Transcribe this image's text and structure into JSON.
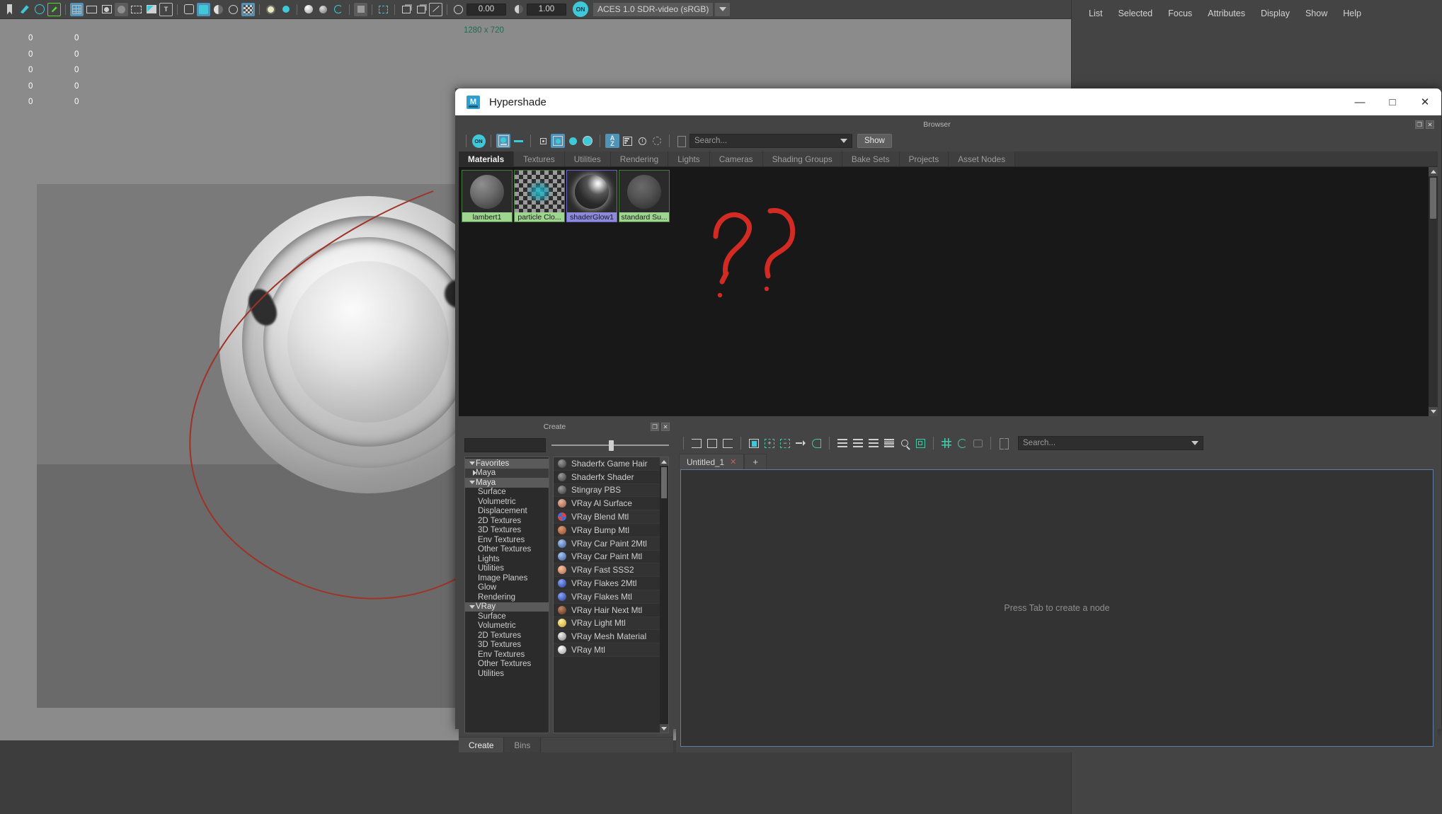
{
  "maya": {
    "statusline": {
      "numeric_fields": [
        "0.00",
        "1.00"
      ],
      "on_toggle_label": "ON",
      "colorspace": "ACES 1.0 SDR-video (sRGB)",
      "icons": [
        "bookmark-icon",
        "paint-brush-icon",
        "move-snap-icon",
        "pencil-icon",
        "grid-snap-icon",
        "view-snap-icon",
        "point-snap-icon",
        "plane-snap-icon",
        "render-region-icon",
        "image-snap-icon",
        "text-snap-icon",
        "cube-wire-icon",
        "cube-solid-icon",
        "half-shade-icon",
        "cage-icon",
        "checker-icon",
        "light-icon",
        "shaded-sphere-icon",
        "texture-sphere-icon",
        "xray-sphere-icon",
        "wire-circle-icon",
        "object-mask-icon",
        "select-marquee-icon",
        "duplicate-icon",
        "copy-icon",
        "diagonal-icon",
        "aperture-icon",
        "contrast-icon"
      ]
    },
    "viewport": {
      "resolution_label": "1280 x 720",
      "hud_left_column": [
        "0",
        "0",
        "0",
        "0",
        "0"
      ],
      "hud_right_column": [
        "0",
        "0",
        "0",
        "0",
        "0"
      ]
    },
    "right_panel": {
      "menu": [
        "List",
        "Selected",
        "Focus",
        "Attributes",
        "Display",
        "Show",
        "Help"
      ]
    }
  },
  "hypershade": {
    "title": "Hypershade",
    "window_buttons": {
      "minimize": "—",
      "maximize": "□",
      "close": "✕"
    },
    "browser": {
      "panel_title": "Browser",
      "panel_buttons": {
        "float": "❐",
        "close": "✕"
      },
      "toolbar": {
        "search_placeholder": "Search...",
        "show_button": "Show",
        "icons": [
          "toggle-on-icon",
          "render-swatch-icon",
          "clear-graph-icon",
          "small-swatch-icon",
          "medium-swatch-icon",
          "large-swatch-icon",
          "xlarge-swatch-icon",
          "sort-alphabetical-icon",
          "sort-reverse-icon",
          "sort-time-icon",
          "refresh-icon",
          "expand-brackets-icon"
        ]
      },
      "tabs": [
        {
          "label": "Materials",
          "active": true
        },
        {
          "label": "Textures",
          "active": false
        },
        {
          "label": "Utilities",
          "active": false
        },
        {
          "label": "Rendering",
          "active": false
        },
        {
          "label": "Lights",
          "active": false
        },
        {
          "label": "Cameras",
          "active": false
        },
        {
          "label": "Shading Groups",
          "active": false
        },
        {
          "label": "Bake Sets",
          "active": false
        },
        {
          "label": "Projects",
          "active": false
        },
        {
          "label": "Asset Nodes",
          "active": false
        }
      ],
      "swatches": [
        {
          "label": "lambert1",
          "kind": "lambert",
          "selected": false
        },
        {
          "label": "particle Clo...",
          "kind": "particlecloud",
          "selected": false
        },
        {
          "label": "shaderGlow1",
          "kind": "glow",
          "selected": true
        },
        {
          "label": "standard Su...",
          "kind": "standard",
          "selected": false
        }
      ],
      "annotation": "red-question-marks"
    },
    "create_panel": {
      "panel_title": "Create",
      "panel_buttons": {
        "float": "❐",
        "close": "✕"
      },
      "filter_value": "",
      "tree": [
        {
          "label": "Favorites",
          "level": 0,
          "state": "expanded",
          "style": "grp"
        },
        {
          "label": "Maya",
          "level": 1,
          "state": "collapsed",
          "style": "sub"
        },
        {
          "label": "Maya",
          "level": 0,
          "state": "expanded",
          "style": "grp"
        },
        {
          "label": "Surface",
          "level": 1,
          "state": "leaf",
          "style": "child"
        },
        {
          "label": "Volumetric",
          "level": 1,
          "state": "leaf",
          "style": "child"
        },
        {
          "label": "Displacement",
          "level": 1,
          "state": "leaf",
          "style": "child"
        },
        {
          "label": "2D Textures",
          "level": 1,
          "state": "leaf",
          "style": "child"
        },
        {
          "label": "3D Textures",
          "level": 1,
          "state": "leaf",
          "style": "child"
        },
        {
          "label": "Env Textures",
          "level": 1,
          "state": "leaf",
          "style": "child"
        },
        {
          "label": "Other Textures",
          "level": 1,
          "state": "leaf",
          "style": "child"
        },
        {
          "label": "Lights",
          "level": 1,
          "state": "leaf",
          "style": "child"
        },
        {
          "label": "Utilities",
          "level": 1,
          "state": "leaf",
          "style": "child"
        },
        {
          "label": "Image Planes",
          "level": 1,
          "state": "leaf",
          "style": "child"
        },
        {
          "label": "Glow",
          "level": 1,
          "state": "leaf",
          "style": "child"
        },
        {
          "label": "Rendering",
          "level": 1,
          "state": "leaf",
          "style": "child"
        },
        {
          "label": "VRay",
          "level": 0,
          "state": "expanded",
          "style": "grp"
        },
        {
          "label": "Surface",
          "level": 1,
          "state": "leaf",
          "style": "child"
        },
        {
          "label": "Volumetric",
          "level": 1,
          "state": "leaf",
          "style": "child"
        },
        {
          "label": "2D Textures",
          "level": 1,
          "state": "leaf",
          "style": "child"
        },
        {
          "label": "3D Textures",
          "level": 1,
          "state": "leaf",
          "style": "child"
        },
        {
          "label": "Env Textures",
          "level": 1,
          "state": "leaf",
          "style": "child"
        },
        {
          "label": "Other Textures",
          "level": 1,
          "state": "leaf",
          "style": "child"
        },
        {
          "label": "Utilities",
          "level": 1,
          "state": "leaf",
          "style": "child"
        }
      ],
      "node_list": [
        {
          "label": "Shaderfx Game Hair",
          "color": "#6f6f6f"
        },
        {
          "label": "Shaderfx Shader",
          "color": "#6f6f6f"
        },
        {
          "label": "Stingray PBS",
          "color": "#6f6f6f"
        },
        {
          "label": "VRay Al Surface",
          "color": "#d8a08a"
        },
        {
          "label": "VRay Blend Mtl",
          "color": "#5a7fd0"
        },
        {
          "label": "VRay Bump Mtl",
          "color": "#c07a5a"
        },
        {
          "label": "VRay Car Paint 2Mtl",
          "color": "#7aa8e0"
        },
        {
          "label": "VRay Car Paint Mtl",
          "color": "#7aa8e0"
        },
        {
          "label": "VRay Fast SSS2",
          "color": "#e8a88a"
        },
        {
          "label": "VRay Flakes 2Mtl",
          "color": "#5a6fd8"
        },
        {
          "label": "VRay Flakes Mtl",
          "color": "#5a6fd8"
        },
        {
          "label": "VRay Hair Next Mtl",
          "color": "#a06a4a"
        },
        {
          "label": "VRay Light Mtl",
          "color": "#e8d07a"
        },
        {
          "label": "VRay Mesh Material",
          "color": "#c8c8c8"
        },
        {
          "label": "VRay Mtl",
          "color": "#d8d8d8"
        }
      ],
      "tabs": [
        {
          "label": "Create",
          "active": true
        },
        {
          "label": "Bins",
          "active": false
        }
      ]
    },
    "node_editor": {
      "toolbar": {
        "search_placeholder": "Search...",
        "icons": [
          "input-connections-icon",
          "input-output-connections-icon",
          "output-connections-icon",
          "rearrange-graph-icon",
          "add-selected-icon",
          "remove-selected-icon",
          "pin-icon",
          "connect-icon",
          "simple-view-icon",
          "connected-view-icon",
          "full-view-icon",
          "list-view-icon",
          "zoom-icon",
          "layout-icon",
          "grid-toggle-icon",
          "snap-grid-icon",
          "show-history-icon",
          "expand-brackets-icon"
        ]
      },
      "tabs": [
        {
          "label": "Untitled_1",
          "close": "✕",
          "active": true
        }
      ],
      "add_tab_label": "+",
      "canvas_hint": "Press Tab to create a node"
    }
  }
}
